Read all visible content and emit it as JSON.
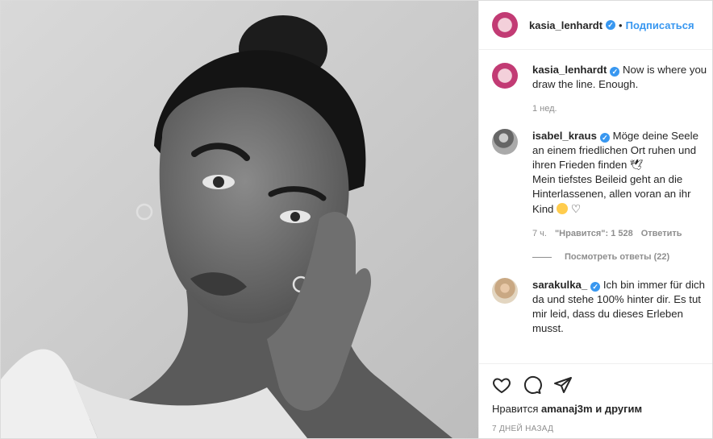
{
  "header": {
    "username": "kasia_lenhardt",
    "verified_mark": "✓",
    "separator": "•",
    "follow_label": "Подписаться"
  },
  "caption": {
    "username": "kasia_lenhardt",
    "text": "Now is where you draw the line. Enough.",
    "age": "1 нед."
  },
  "comments": [
    {
      "username": "isabel_kraus",
      "text_line1": "Möge deine Seele an einem friedlichen Ort ruhen und ihren Frieden finden 🕊",
      "text_line2": "Mein tiefstes Beileid geht an die Hinterlassenen, allen voran an ihr Kind",
      "heart": "♡",
      "age": "7 ч.",
      "likes": "\"Нравится\": 1 528",
      "reply_label": "Ответить",
      "view_replies": "Посмотреть ответы (22)"
    },
    {
      "username": "sarakulka_",
      "text": "Ich bin immer für dich da und stehe 100% hinter dir. Es tut mir leid, dass du dieses Erleben musst."
    }
  ],
  "footer": {
    "likes_prefix": "Нравится",
    "likes_user": "amanaj3m",
    "likes_suffix": "и другим",
    "date": "7 ДНЕЙ НАЗАД"
  },
  "icons": {
    "like": "heart-icon",
    "comment": "comment-icon",
    "share": "share-icon"
  },
  "colors": {
    "accent": "#3897f0",
    "muted": "#8e8e8e"
  }
}
